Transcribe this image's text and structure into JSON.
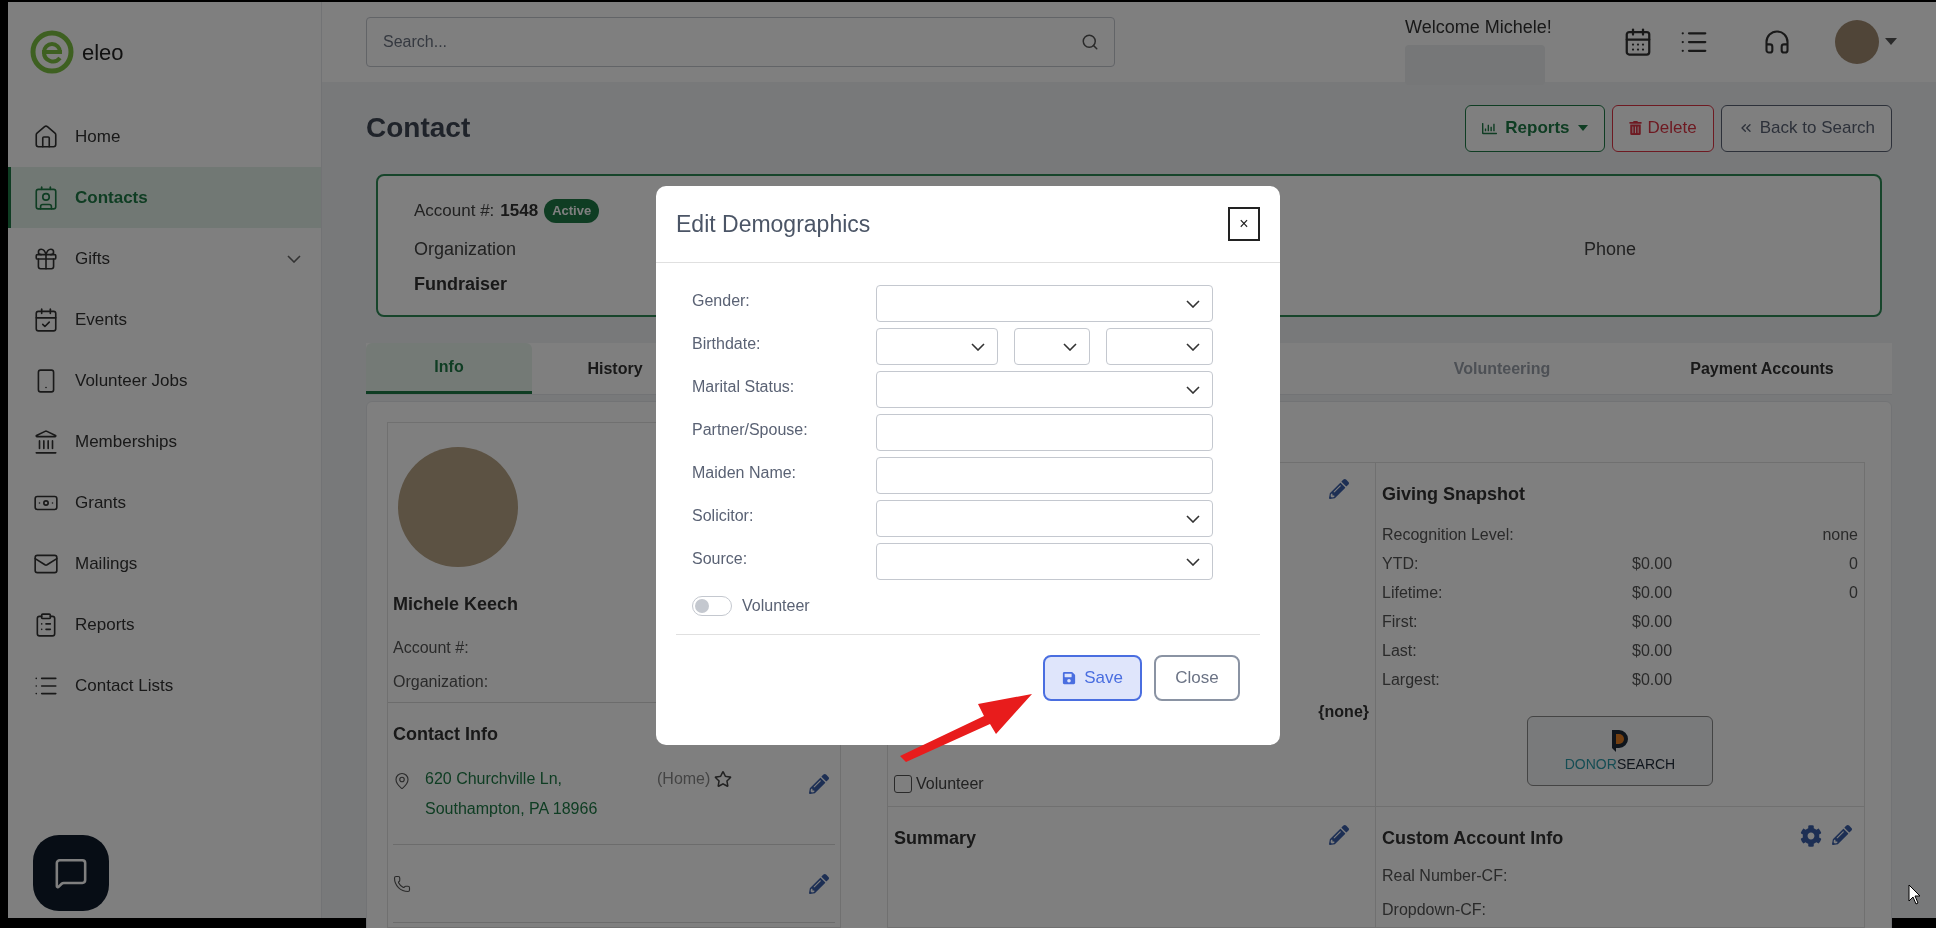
{
  "brand": {
    "name": "eleo"
  },
  "sidebar": {
    "items": [
      {
        "label": "Home",
        "selected": false,
        "kind": "link"
      },
      {
        "label": "Contacts",
        "selected": true,
        "kind": "link"
      },
      {
        "label": "Gifts",
        "selected": false,
        "kind": "group"
      },
      {
        "label": "Events",
        "selected": false,
        "kind": "link"
      },
      {
        "label": "Volunteer Jobs",
        "selected": false,
        "kind": "link"
      },
      {
        "label": "Memberships",
        "selected": false,
        "kind": "link"
      },
      {
        "label": "Grants",
        "selected": false,
        "kind": "link"
      },
      {
        "label": "Mailings",
        "selected": false,
        "kind": "link"
      },
      {
        "label": "Reports",
        "selected": false,
        "kind": "link"
      },
      {
        "label": "Contact Lists",
        "selected": false,
        "kind": "link"
      }
    ]
  },
  "topbar": {
    "search": {
      "placeholder": "Search..."
    },
    "welcome": "Welcome Michele!"
  },
  "page": {
    "title": "Contact",
    "actions": [
      {
        "label": "Reports",
        "kind": "dropdown"
      },
      {
        "label": "Delete",
        "kind": "danger"
      },
      {
        "label": "Back to Search",
        "kind": "back"
      }
    ]
  },
  "account": {
    "label": "Account #:",
    "number": "1548",
    "status": "Active",
    "fields": [
      {
        "label": "Organization",
        "value": "Fundraiser"
      },
      {
        "label": "Phone"
      }
    ]
  },
  "tabs": [
    {
      "label": "Info",
      "selected": true,
      "disabled": false
    },
    {
      "label": "History",
      "selected": false,
      "disabled": false
    },
    {
      "label": "Volunteering",
      "selected": false,
      "disabled": true
    },
    {
      "label": "Payment Accounts",
      "selected": false,
      "disabled": false
    }
  ],
  "profile": {
    "name": "Michele Keech",
    "fields": [
      "Account #:",
      "Organization:"
    ]
  },
  "contact_info": {
    "title": "Contact Info",
    "address": {
      "lines": [
        "620 Churchville Ln,",
        "Southampton, PA 18966"
      ],
      "type": "(Home)",
      "favorite": false
    }
  },
  "demographics_card": {
    "value": "{none}",
    "volunteer": {
      "label": "Volunteer",
      "checked": false
    }
  },
  "giving_snapshot": {
    "title": "Giving Snapshot",
    "rows": [
      {
        "label": "Recognition Level:",
        "value": "none"
      },
      {
        "label": "YTD:",
        "amount": "$0.00",
        "count": "0"
      },
      {
        "label": "Lifetime:",
        "amount": "$0.00",
        "count": "0"
      },
      {
        "label": "First:",
        "amount": "$0.00"
      },
      {
        "label": "Last:",
        "amount": "$0.00"
      },
      {
        "label": "Largest:",
        "amount": "$0.00"
      }
    ],
    "donorsearch": {
      "part_1": "DONOR",
      "part_2": "SEARCH"
    }
  },
  "summary": {
    "title": "Summary"
  },
  "custom_info": {
    "title": "Custom Account Info",
    "fields": [
      "Real Number-CF:",
      "Dropdown-CF:"
    ]
  },
  "modal": {
    "title": "Edit Demographics",
    "close": "×",
    "fields": [
      {
        "label": "Gender:",
        "kind": "select"
      },
      {
        "label": "Birthdate:",
        "kind": "date"
      },
      {
        "label": "Marital Status:",
        "kind": "select"
      },
      {
        "label": "Partner/Spouse:",
        "kind": "text"
      },
      {
        "label": "Maiden Name:",
        "kind": "text"
      },
      {
        "label": "Solicitor:",
        "kind": "select"
      },
      {
        "label": "Source:",
        "kind": "select"
      }
    ],
    "volunteer": {
      "label": "Volunteer",
      "on": false
    },
    "buttons": [
      {
        "label": "Save",
        "kind": "primary"
      },
      {
        "label": "Close",
        "kind": "secondary"
      }
    ]
  }
}
